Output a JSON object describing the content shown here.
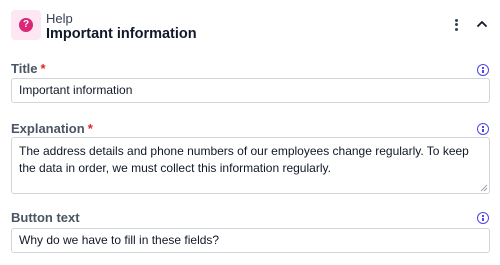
{
  "header": {
    "block_type": "Help",
    "title": "Important information"
  },
  "fields": {
    "title": {
      "label": "Title",
      "required_marker": "*",
      "value": "Important information"
    },
    "explanation": {
      "label": "Explanation",
      "required_marker": "*",
      "value": "The address details and phone numbers of our employees change regularly. To keep the data in order, we must collect this information regularly."
    },
    "button_text": {
      "label": "Button text",
      "value": "Why do we have to fill in these fields?"
    }
  },
  "icons": {
    "help": "question-circle-icon",
    "menu": "kebab-menu-icon",
    "collapse": "chevron-up-icon",
    "info": "info-circle-icon"
  },
  "colors": {
    "accent_pink": "#db2777",
    "icon_bg": "#fce7f3",
    "required": "#dc2626",
    "info": "#4f46e5"
  }
}
